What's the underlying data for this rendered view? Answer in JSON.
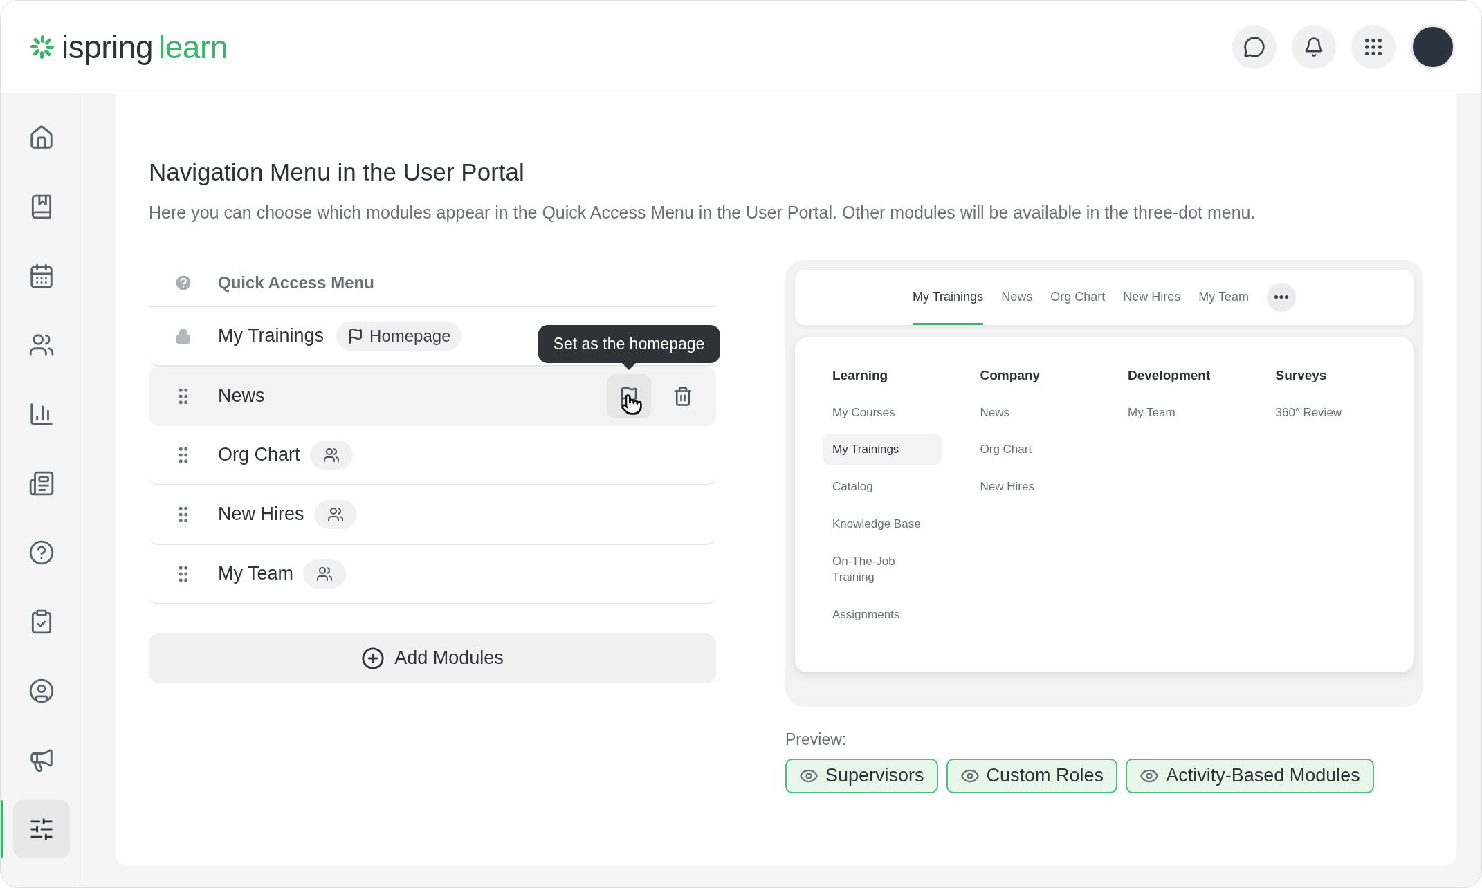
{
  "header": {
    "logo": {
      "brand": "ispring",
      "product": "learn"
    }
  },
  "sidebar": {
    "items": [
      {
        "selected": false
      },
      {
        "selected": false
      },
      {
        "selected": false
      },
      {
        "selected": false
      },
      {
        "selected": false
      },
      {
        "selected": false
      },
      {
        "selected": false
      },
      {
        "selected": false
      },
      {
        "selected": false
      },
      {
        "selected": false
      },
      {
        "selected": true
      }
    ]
  },
  "page": {
    "title": "Navigation Menu in the User Portal",
    "description": "Here you can choose which modules appear in the Quick Access Menu in the User Portal. Other modules will be available in the three-dot menu."
  },
  "quick_access": {
    "heading": "Quick Access Menu",
    "items": [
      {
        "label": "My Trainings",
        "kind": "locked",
        "badge": "Homepage",
        "hovered": false
      },
      {
        "label": "News",
        "kind": "draggable",
        "hovered": true,
        "tooltip": "Set as the homepage"
      },
      {
        "label": "Org Chart",
        "kind": "draggable",
        "audience": true,
        "hovered": false
      },
      {
        "label": "New Hires",
        "kind": "draggable",
        "audience": true,
        "hovered": false
      },
      {
        "label": "My Team",
        "kind": "draggable",
        "audience": true,
        "hovered": false
      }
    ],
    "add_button": "Add Modules"
  },
  "preview": {
    "tabs": [
      {
        "label": "My Trainings",
        "selected": true
      },
      {
        "label": "News",
        "selected": false
      },
      {
        "label": "Org Chart",
        "selected": false
      },
      {
        "label": "New Hires",
        "selected": false
      },
      {
        "label": "My Team",
        "selected": false
      }
    ],
    "columns": [
      {
        "heading": "Learning",
        "items": [
          {
            "label": "My Courses",
            "selected": false
          },
          {
            "label": "My Trainings",
            "selected": true
          },
          {
            "label": "Catalog",
            "selected": false
          },
          {
            "label": "Knowledge Base",
            "selected": false
          },
          {
            "label": "On-The-Job Training",
            "selected": false
          },
          {
            "label": "Assignments",
            "selected": false
          }
        ]
      },
      {
        "heading": "Company",
        "items": [
          {
            "label": "News",
            "selected": false
          },
          {
            "label": "Org Chart",
            "selected": false
          },
          {
            "label": "New Hires",
            "selected": false
          }
        ]
      },
      {
        "heading": "Development",
        "items": [
          {
            "label": "My Team",
            "selected": false
          }
        ]
      },
      {
        "heading": "Surveys",
        "items": [
          {
            "label": "360° Review",
            "selected": false
          }
        ]
      }
    ],
    "label": "Preview:",
    "buttons": [
      "Supervisors",
      "Custom Roles",
      "Activity-Based Modules"
    ]
  }
}
